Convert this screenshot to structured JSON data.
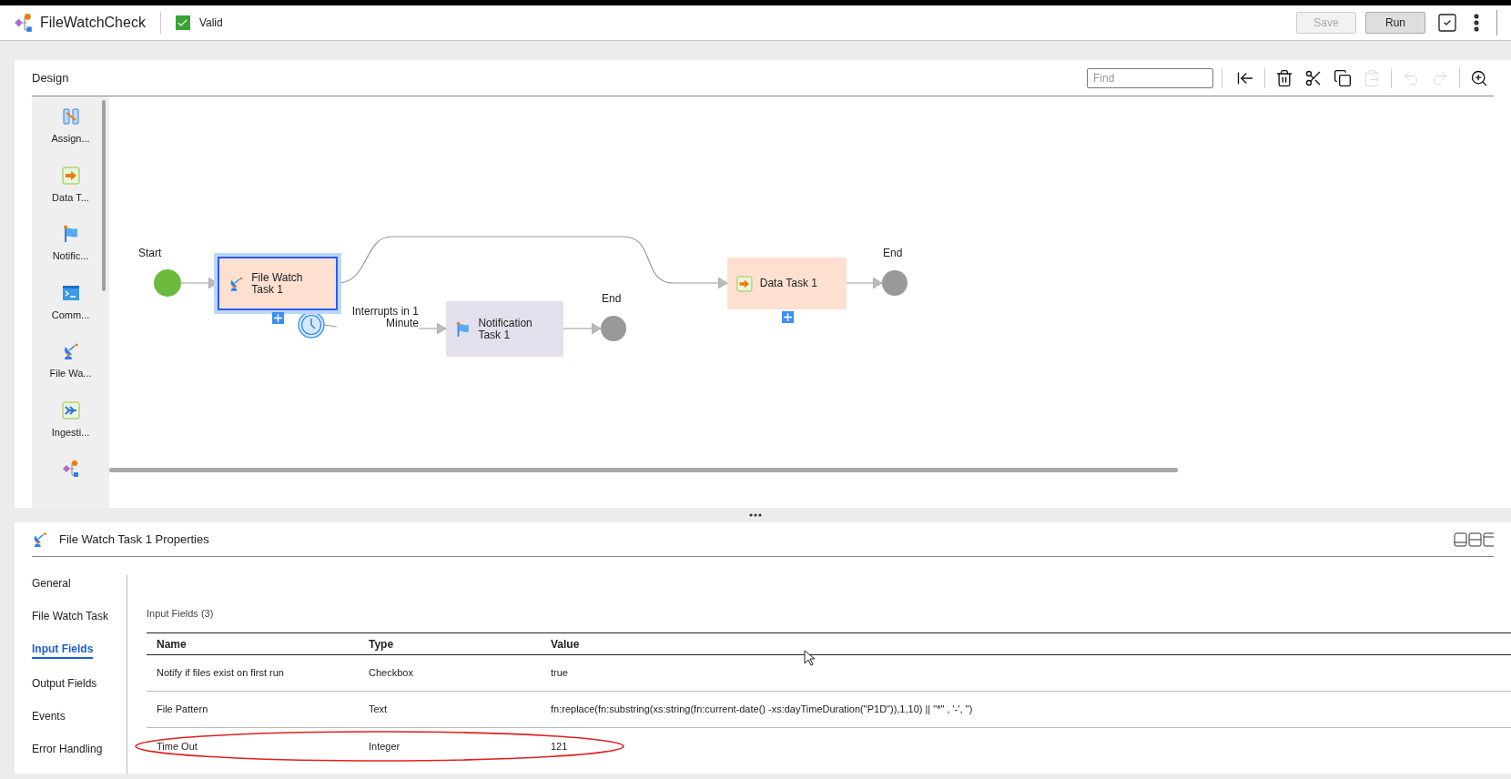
{
  "app": {
    "title": "FileWatchCheck",
    "status": "Valid",
    "valid": true,
    "buttons": [
      {
        "label": "Save",
        "disabled": true
      },
      {
        "label": "Run",
        "disabled": false
      }
    ]
  },
  "design": {
    "title": "Design",
    "find_placeholder": "Find",
    "toolbar": [
      {
        "kind": "collapse",
        "disabled": false
      },
      {
        "kind": "delete",
        "disabled": false
      },
      {
        "kind": "cut",
        "disabled": false
      },
      {
        "kind": "copy",
        "disabled": false
      },
      {
        "kind": "paste",
        "disabled": true
      },
      {
        "kind": "undo",
        "disabled": true
      },
      {
        "kind": "redo",
        "disabled": true
      },
      {
        "kind": "zoom",
        "disabled": false
      }
    ],
    "palette": [
      {
        "label": "Assign...",
        "kind": "assignment"
      },
      {
        "label": "Data T...",
        "kind": "data"
      },
      {
        "label": "Notific...",
        "kind": "notification"
      },
      {
        "label": "Comm...",
        "kind": "command"
      },
      {
        "label": "File Wa...",
        "kind": "file_watch"
      },
      {
        "label": "Ingesti...",
        "kind": "ingestion"
      },
      {
        "kind": "process"
      }
    ],
    "diagram": {
      "start_label": "Start",
      "end_labels": [
        "End",
        "End"
      ],
      "timer_label": "Interrupts in 1 Minute",
      "tasks": [
        {
          "label": "File Watch Task 1",
          "kind": "file_watch",
          "selected": true
        },
        {
          "label": "Notification Task 1",
          "kind": "notification",
          "selected": false
        },
        {
          "label": "Data Task 1",
          "kind": "data",
          "selected": false
        }
      ]
    }
  },
  "properties": {
    "title": "File Watch Task 1 Properties",
    "nav": [
      {
        "label": "General",
        "selected": false
      },
      {
        "label": "File Watch Task",
        "selected": false
      },
      {
        "label": "Input Fields",
        "selected": true
      },
      {
        "label": "Output Fields",
        "selected": false
      },
      {
        "label": "Events",
        "selected": false
      },
      {
        "label": "Error Handling",
        "selected": false
      }
    ],
    "section_title": "Input Fields (3)",
    "columns": [
      "Name",
      "Type",
      "Value"
    ],
    "rows": [
      {
        "cells": [
          "Notify if files exist on first run",
          "Checkbox",
          "true"
        ],
        "highlighted": false
      },
      {
        "cells": [
          "File Pattern",
          "Text",
          "fn:replace(fn:substring(xs:string(fn:current-date() -xs:dayTimeDuration(\"P1D\")),1,10) || \"*\" , '-', '')"
        ],
        "highlighted": false
      },
      {
        "cells": [
          "Time Out",
          "Integer",
          "121"
        ],
        "highlighted": true
      }
    ]
  }
}
